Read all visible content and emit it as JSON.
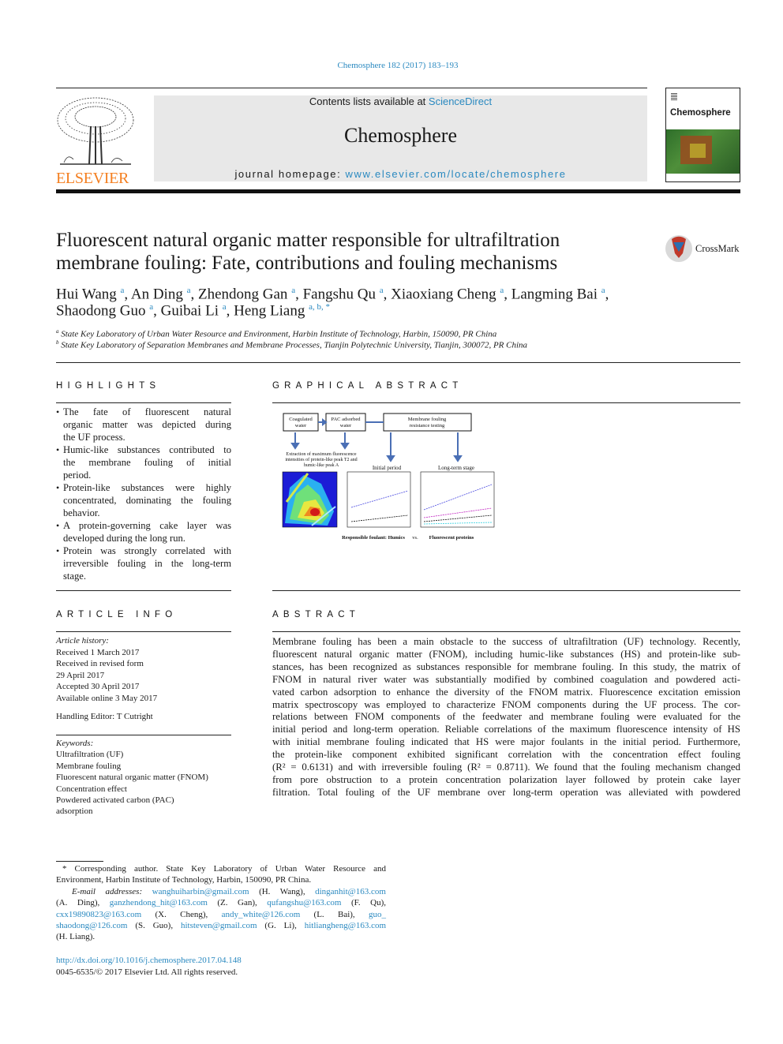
{
  "journal_ref": "Chemosphere 182 (2017) 183–193",
  "header": {
    "publisher_logo_text": "ELSEVIER",
    "contents_prefix": "Contents lists available at ",
    "contents_link": "ScienceDirect",
    "journal_title": "Chemosphere",
    "homepage_prefix": "journal homepage: ",
    "homepage_link": "www.elsevier.com/locate/chemosphere",
    "cover_title": "Chemosphere"
  },
  "article": {
    "title_lines": [
      "Fluorescent natural organic matter responsible for ultrafiltration",
      "membrane fouling: Fate, contributions and fouling mechanisms"
    ],
    "crossmark": "CrossMark",
    "authors_line1": [
      {
        "name": "Hui Wang",
        "sup": "a",
        "sep": ", "
      },
      {
        "name": "An Ding",
        "sup": "a",
        "sep": ", "
      },
      {
        "name": "Zhendong Gan",
        "sup": "a",
        "sep": ", "
      },
      {
        "name": "Fangshu Qu",
        "sup": "a",
        "sep": ", "
      },
      {
        "name": "Xiaoxiang Cheng",
        "sup": "a",
        "sep": ", "
      },
      {
        "name": "Langming Bai",
        "sup": "a",
        "sep": ","
      }
    ],
    "authors_line2": [
      {
        "name": "Shaodong Guo",
        "sup": "a",
        "sep": ", "
      },
      {
        "name": "Guibai Li",
        "sup": "a",
        "sep": ", "
      },
      {
        "name": "Heng Liang",
        "sup": "a, b, *",
        "sep": ""
      }
    ],
    "affiliations": [
      {
        "sup": "a",
        "text": "State Key Laboratory of Urban Water Resource and Environment, Harbin Institute of Technology, Harbin, 150090, PR China"
      },
      {
        "sup": "b",
        "text": "State Key Laboratory of Separation Membranes and Membrane Processes, Tianjin Polytechnic University, Tianjin, 300072, PR China"
      }
    ]
  },
  "highlights": {
    "heading": "HIGHLIGHTS",
    "lines": [
      {
        "b": true,
        "t": "The fate of fluorescent natural"
      },
      {
        "t": "organic matter was depicted during"
      },
      {
        "t": "the UF process.",
        "last": true
      },
      {
        "b": true,
        "t": "Humic-like substances contributed to"
      },
      {
        "t": "the membrane fouling of initial"
      },
      {
        "t": "period.",
        "last": true
      },
      {
        "b": true,
        "t": "Protein-like substances were highly"
      },
      {
        "t": "concentrated, dominating the fouling"
      },
      {
        "t": "behavior.",
        "last": true
      },
      {
        "b": true,
        "t": "A protein-governing cake layer was"
      },
      {
        "t": "developed during the long run.",
        "last": true
      },
      {
        "b": true,
        "t": "Protein was strongly correlated with"
      },
      {
        "t": "irreversible fouling in the long-term"
      },
      {
        "t": "stage.",
        "last": true
      }
    ]
  },
  "graphical_abstract": {
    "heading": "GRAPHICAL ABSTRACT",
    "box_coagulated": [
      "Coagulated",
      "water"
    ],
    "box_pac": [
      "PAC adsorbed",
      "water"
    ],
    "box_membrane": [
      "Membrane fouling",
      "resistance testing"
    ],
    "extraction": [
      "Extraction of maximum fluorescence",
      "intensities of protein-like peak T2 and",
      "humic-like peak A"
    ],
    "initial_period": "Initial period",
    "long_term": "Long-term stage",
    "bottom_left": "Responsible foulant: Humics",
    "bottom_vs": "vs.",
    "bottom_right": "Fluorescent proteins"
  },
  "article_info": {
    "heading": "ARTICLE INFO",
    "history_label": "Article history:",
    "history": [
      "Received 1 March 2017",
      "Received in revised form",
      "29 April 2017",
      "Accepted 30 April 2017",
      "Available online 3 May 2017"
    ],
    "handling_editor": "Handling Editor: T Cutright",
    "keywords_label": "Keywords:",
    "keywords": [
      "Ultrafiltration (UF)",
      "Membrane fouling",
      "Fluorescent natural organic matter (FNOM)",
      "Concentration effect",
      "Powdered activated carbon (PAC)",
      "adsorption"
    ]
  },
  "abstract": {
    "heading": "ABSTRACT",
    "lines": [
      "Membrane fouling has been a main obstacle to the success of ultrafiltration (UF) technology. Recently,",
      "fluorescent natural organic matter (FNOM), including humic-like substances (HS) and protein-like sub-",
      "stances, has been recognized as substances responsible for membrane fouling. In this study, the matrix of",
      "FNOM in natural river water was substantially modified by combined coagulation and powdered acti-",
      "vated carbon adsorption to enhance the diversity of the FNOM matrix. Fluorescence excitation emission",
      "matrix spectroscopy was employed to characterize FNOM components during the UF process. The cor-",
      "relations between FNOM components of the feedwater and membrane fouling were evaluated for the",
      "initial period and long-term operation. Reliable correlations of the maximum fluorescence intensity of HS",
      "with initial membrane fouling indicated that HS were major foulants in the initial period. Furthermore,",
      "the protein-like component exhibited significant correlation with the concentration effect fouling",
      "(R² = 0.6131) and with irreversible fouling (R² = 0.8711). We found that the fouling mechanism changed",
      "from pore obstruction to a protein concentration polarization layer followed by protein cake layer",
      "filtration. Total fouling of the UF membrane over long-term operation was alleviated with powdered"
    ]
  },
  "footnote": {
    "corresponding": [
      "* Corresponding author. State Key Laboratory of Urban Water Resource and",
      "Environment, Harbin Institute of Technology, Harbin, 150090, PR China."
    ],
    "email_label": "E-mail addresses:",
    "email_lines": [
      [
        {
          "l": "wanghuiharbin@gmail.com"
        },
        {
          "t": " (H. Wang), "
        },
        {
          "l": "dinganhit@163.com"
        }
      ],
      [
        {
          "t": "(A. Ding), "
        },
        {
          "l": "ganzhendong_hit@163.com"
        },
        {
          "t": " (Z. Gan), "
        },
        {
          "l": "qufangshu@163.com"
        },
        {
          "t": " (F. Qu),"
        }
      ],
      [
        {
          "l": "cxx19890823@163.com"
        },
        {
          "t": " (X. Cheng), "
        },
        {
          "l": "andy_white@126.com"
        },
        {
          "t": " (L. Bai), "
        },
        {
          "l": "guo_"
        }
      ],
      [
        {
          "l": "shaodong@126.com"
        },
        {
          "t": " (S. Guo), "
        },
        {
          "l": "hitsteven@gmail.com"
        },
        {
          "t": " (G. Li), "
        },
        {
          "l": "hitliangheng@163.com"
        }
      ],
      [
        {
          "t": "(H. Liang)."
        }
      ]
    ],
    "doi": "http://dx.doi.org/10.1016/j.chemosphere.2017.04.148",
    "copyright": "0045-6535/© 2017 Elsevier Ltd. All rights reserved."
  },
  "colors": {
    "link": "#2a89c0",
    "elsevier_orange": "#f47f20",
    "header_bg": "#e8e8e8"
  }
}
